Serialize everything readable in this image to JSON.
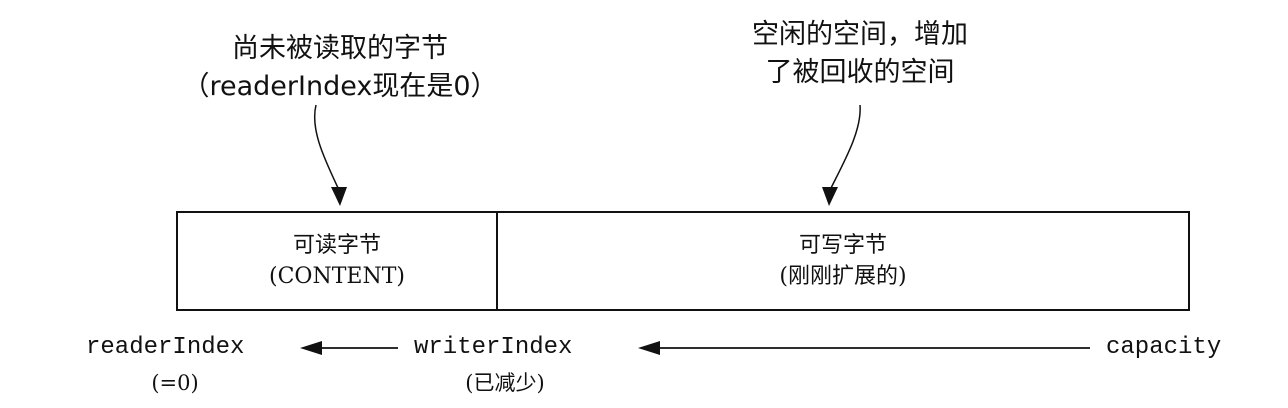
{
  "callouts": {
    "unread": {
      "line1": "尚未被读取的字节",
      "line2": "（readerIndex现在是0）"
    },
    "free": {
      "line1": "空闲的空间，增加",
      "line2": "了被回收的空间"
    }
  },
  "buffer": {
    "readable": {
      "title": "可读字节",
      "subtitle": "(CONTENT)"
    },
    "writable": {
      "title": "可写字节",
      "subtitle": "(刚刚扩展的)"
    }
  },
  "indices": {
    "reader": {
      "name": "readerIndex",
      "note": "(=0)"
    },
    "writer": {
      "name": "writerIndex",
      "note": "(已减少)"
    },
    "capacity": {
      "name": "capacity"
    }
  }
}
